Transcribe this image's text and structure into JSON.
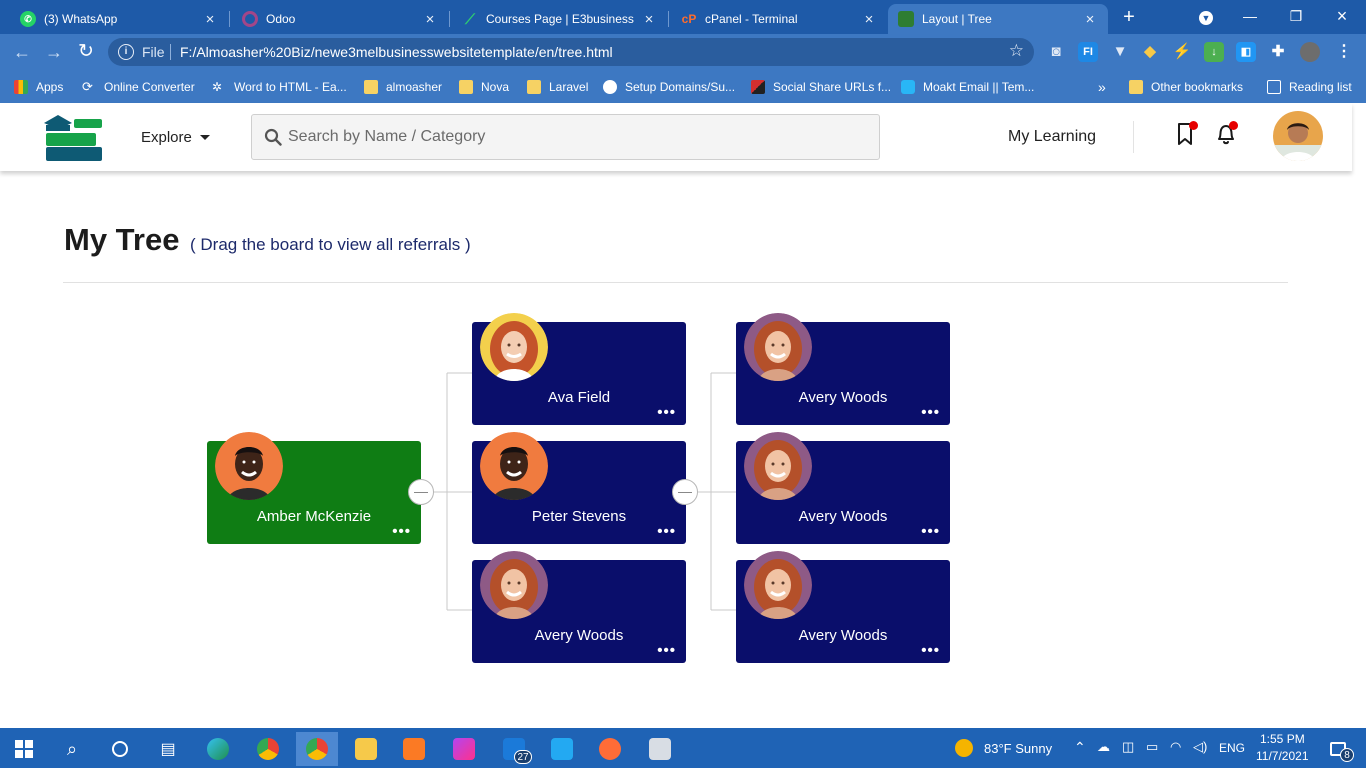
{
  "browser": {
    "tabs": [
      {
        "title": "(3) WhatsApp",
        "icon": "whatsapp-icon",
        "color": "#25d366"
      },
      {
        "title": "Odoo",
        "icon": "odoo-icon",
        "color": "#a24689"
      },
      {
        "title": "Courses Page | E3business",
        "icon": "course-icon",
        "color": "#2ecc71"
      },
      {
        "title": "cPanel - Terminal",
        "icon": "cpanel-icon",
        "color": "#ff6c2c"
      },
      {
        "title": "Layout | Tree",
        "icon": "layout-icon",
        "color": "#4caf50"
      }
    ],
    "address": {
      "scheme_label": "File",
      "url": "F:/Almoasher%20Biz/newe3melbusinesswebsitetemplate/en/tree.html"
    },
    "bookmarks": [
      {
        "label": "Apps",
        "icon": "apps-grid-icon"
      },
      {
        "label": "Online Converter",
        "icon": "converter-icon"
      },
      {
        "label": "Word to HTML - Ea...",
        "icon": "word-html-icon"
      },
      {
        "label": "almoasher",
        "icon": "folder-icon"
      },
      {
        "label": "Nova",
        "icon": "folder-icon"
      },
      {
        "label": "Laravel",
        "icon": "folder-icon"
      },
      {
        "label": "Setup Domains/Su...",
        "icon": "globe-icon"
      },
      {
        "label": "Social Share URLs f...",
        "icon": "share-icon"
      },
      {
        "label": "Moakt Email || Tem...",
        "icon": "email-icon"
      }
    ],
    "bookmarks_overflow": "»",
    "other_bookmarks": "Other bookmarks",
    "reading_list": "Reading list"
  },
  "header": {
    "explore_label": "Explore",
    "search_placeholder": "Search by Name / Category",
    "my_learning_label": "My Learning"
  },
  "page": {
    "title": "My Tree",
    "subtitle": "( Drag the board to view all referrals )"
  },
  "tree": {
    "root": {
      "name": "Amber McKenzie",
      "menu": "•••"
    },
    "level1": [
      {
        "name": "Ava Field",
        "menu": "•••"
      },
      {
        "name": "Peter Stevens",
        "menu": "•••"
      },
      {
        "name": "Avery Woods",
        "menu": "•••"
      }
    ],
    "level2": [
      {
        "name": "Avery Woods",
        "menu": "•••"
      },
      {
        "name": "Avery Woods",
        "menu": "•••"
      },
      {
        "name": "Avery Woods",
        "menu": "•••"
      }
    ],
    "colors": {
      "root": "#0f7d14",
      "child": "#0a0e6b"
    }
  },
  "taskbar": {
    "weather": "83°F  Sunny",
    "language": "ENG",
    "time": "1:55 PM",
    "date": "11/7/2021",
    "calendar_badge": "27",
    "notification_badge": "8"
  }
}
